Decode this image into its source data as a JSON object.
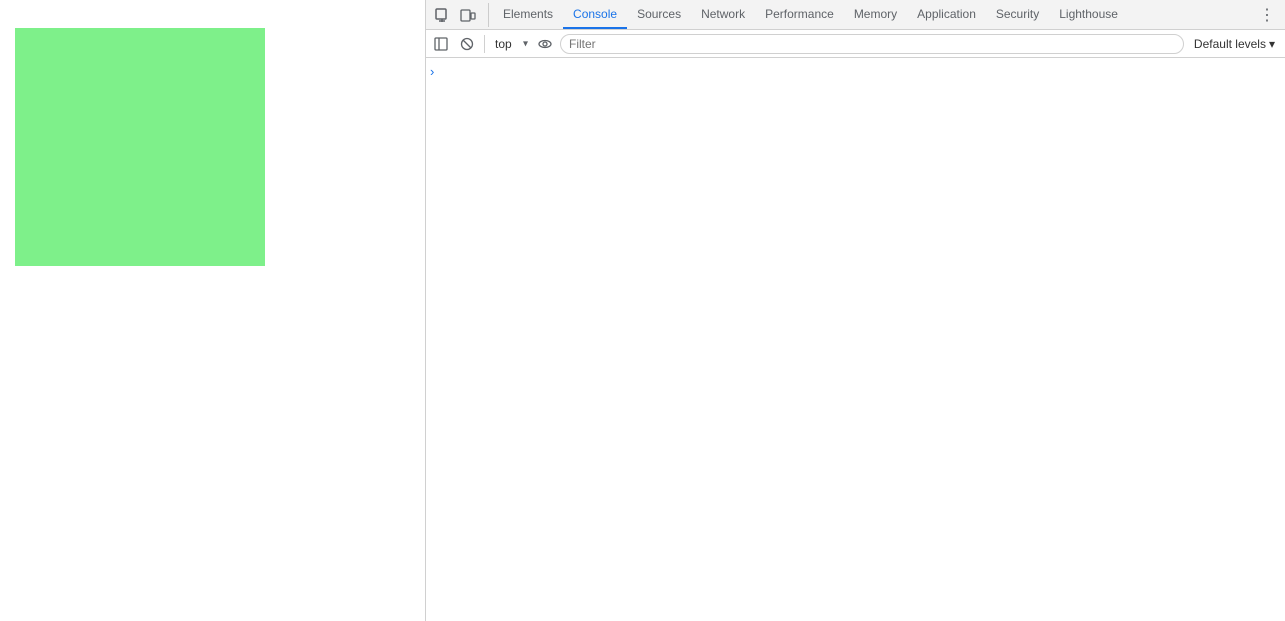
{
  "page": {
    "green_box_color": "#7ef08a"
  },
  "devtools": {
    "tabs": [
      {
        "id": "elements",
        "label": "Elements",
        "active": false
      },
      {
        "id": "console",
        "label": "Console",
        "active": true
      },
      {
        "id": "sources",
        "label": "Sources",
        "active": false
      },
      {
        "id": "network",
        "label": "Network",
        "active": false
      },
      {
        "id": "performance",
        "label": "Performance",
        "active": false
      },
      {
        "id": "memory",
        "label": "Memory",
        "active": false
      },
      {
        "id": "application",
        "label": "Application",
        "active": false
      },
      {
        "id": "security",
        "label": "Security",
        "active": false
      },
      {
        "id": "lighthouse",
        "label": "Lighthouse",
        "active": false
      }
    ],
    "console": {
      "context_value": "top",
      "filter_placeholder": "Filter",
      "default_levels_label": "Default levels"
    }
  }
}
